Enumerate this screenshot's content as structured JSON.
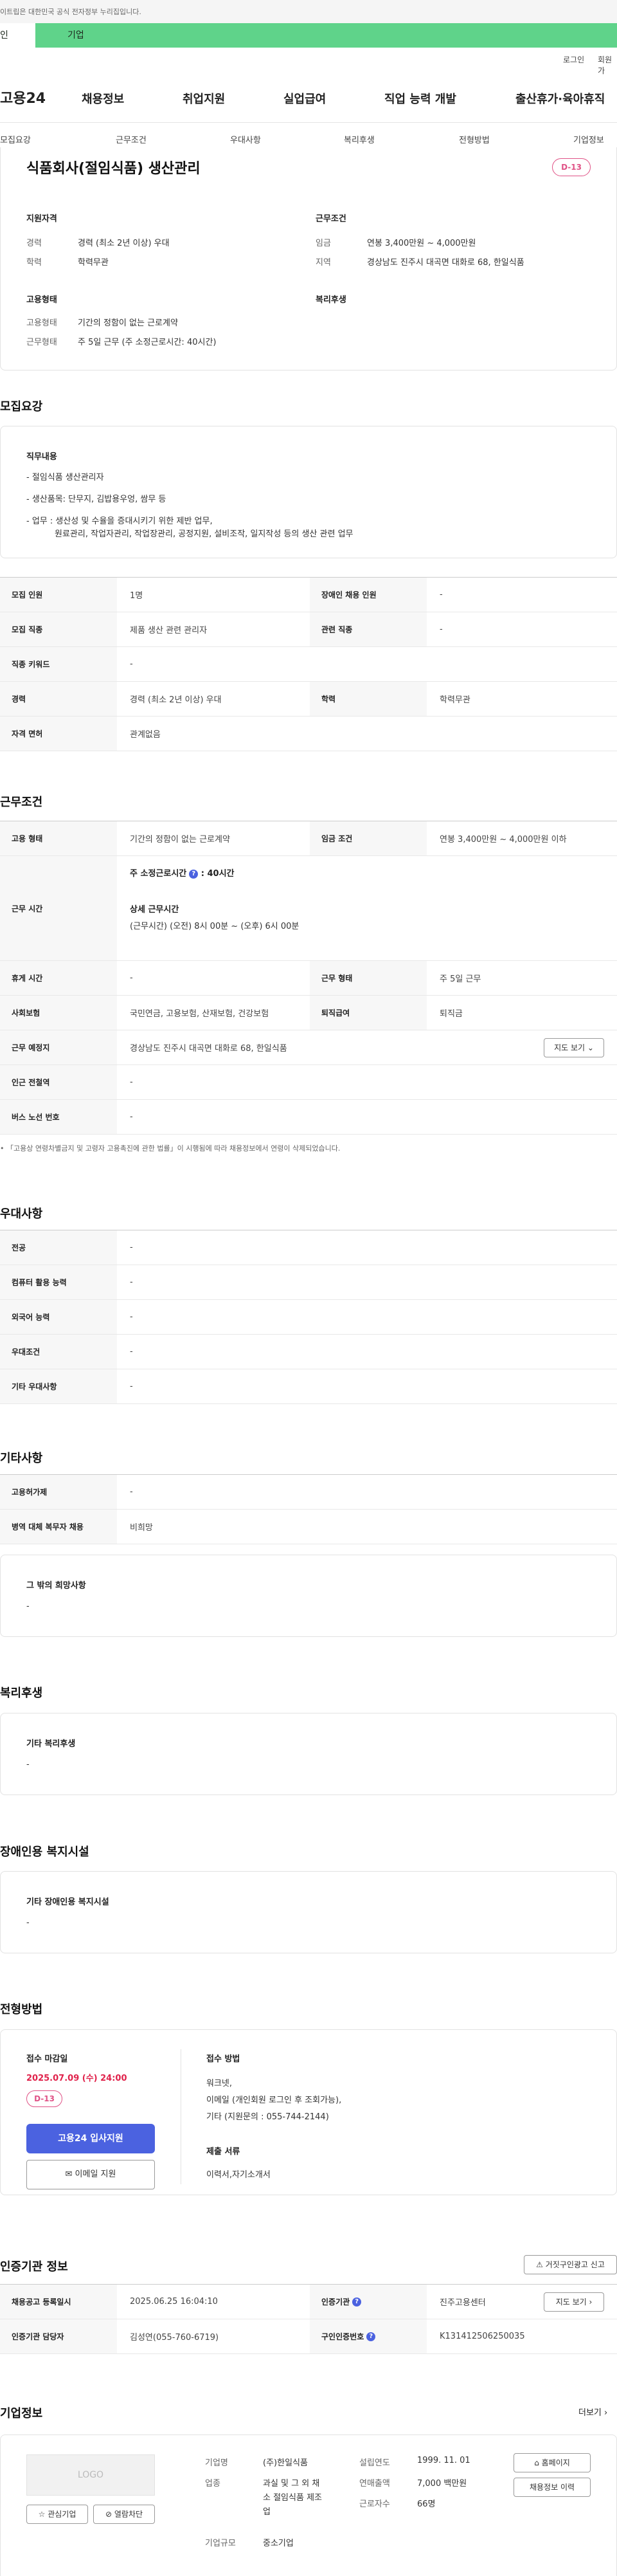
{
  "gov_banner": "이트립은 대한민국 공식 전자정부 누리집입니다.",
  "user_tabs": [
    "인",
    "기업"
  ],
  "util": {
    "login": "로그인",
    "signup": "회원가"
  },
  "logo": "고용24",
  "gnb": [
    "채용정보",
    "취업지원",
    "실업급여",
    "직업 능력 개발",
    "출산휴가·육아휴직"
  ],
  "anchors": [
    "모집요강",
    "근무조건",
    "우대사항",
    "복리후생",
    "전형방법",
    "기업정보"
  ],
  "summary": {
    "title": "식품회사(절임식품) 생산관리",
    "dday": "D-13",
    "applicant_title": "지원자격",
    "career_label": "경력",
    "career": "경력 (최소 2년 이상) 우대",
    "edu_label": "학력",
    "edu": "학력무관",
    "work_title": "근무조건",
    "wage_label": "임금",
    "wage": "연봉 3,400만원 ~ 4,000만원",
    "region_label": "지역",
    "region": "경상남도 진주시 대곡면 대화로 68, 한일식품",
    "emp_title": "고용형태",
    "emp_type_label": "고용형태",
    "emp_type": "기간의 정함이 없는 근로계약",
    "work_form_label": "근무형태",
    "work_form": "주 5일 근무 (주 소정근로시간: 40시간)",
    "welfare_title": "복리후생"
  },
  "recruit": {
    "title": "모집요강",
    "duty_title": "직무내용",
    "duty_lines": [
      "- 절임식품 생산관리자",
      "- 생산품목: 단무지, 김밥용우엉, 쌈무 등",
      "- 업무 : 생산성 및 수율을 증대시키기 위한 제반 업무,",
      "원료관리, 작업자관리, 작업장관리, 공정지원, 설비조작, 일지작성 등의 생산 관련 업무"
    ],
    "rows": [
      [
        "모집 인원",
        "1명",
        "장애인 채용 인원",
        "-"
      ],
      [
        "모집 직종",
        "제품 생산 관련 관리자",
        "관련 직종",
        "-"
      ],
      [
        "직종 키워드",
        "-",
        "",
        ""
      ],
      [
        "경력",
        "경력 (최소 2년 이상) 우대",
        "학력",
        "학력무관"
      ],
      [
        "자격 면허",
        "관계없음",
        "",
        ""
      ]
    ]
  },
  "conditions": {
    "title": "근무조건",
    "emp_label": "고용 형태",
    "emp": "기간의 정함이 없는 근로계약",
    "wage_label": "임금 조건",
    "wage": "연봉 3,400만원 ~ 4,000만원 이하",
    "time_label": "근무 시간",
    "weekly": "주 소정근로시간",
    "weekly_val": ": 40시간",
    "detail_title": "상세 근무시간",
    "detail": "(근무시간) (오전) 8시 00분 ~ (오후) 6시 00분",
    "rows": [
      [
        "휴게 시간",
        "-",
        "근무 형태",
        "주 5일 근무"
      ],
      [
        "사회보험",
        "국민연금, 고용보험, 산재보험, 건강보험",
        "퇴직급여",
        "퇴직금"
      ]
    ],
    "place_label": "근무 예정지",
    "place": "경상남도 진주시 대곡면 대화로 68, 한일식품",
    "map_btn": "지도 보기",
    "station_label": "인근 전철역",
    "station": "-",
    "bus_label": "버스 노선 번호",
    "bus": "-",
    "note": "「고용상 연령차별금지 및 고령자 고용촉진에 관한 법률」이 시행됨에 따라 채용정보에서 연령이 삭제되었습니다."
  },
  "pref": {
    "title": "우대사항",
    "rows": [
      [
        "전공",
        "-"
      ],
      [
        "컴퓨터 활용 능력",
        "-"
      ],
      [
        "외국어 능력",
        "-"
      ],
      [
        "우대조건",
        "-"
      ],
      [
        "기타 우대사항",
        "-"
      ]
    ]
  },
  "etc": {
    "title": "기타사항",
    "rows": [
      [
        "고용허가제",
        "-"
      ],
      [
        "병역 대체 복무자 채용",
        "비희망"
      ]
    ],
    "other_title": "그 밖의 희망사항",
    "other": "-"
  },
  "welfare": {
    "title": "복리후생",
    "sub": "기타 복리후생",
    "val": "-"
  },
  "disabled": {
    "title": "장애인용 복지시설",
    "sub": "기타 장애인용 복지시설",
    "val": "-"
  },
  "process": {
    "title": "전형방법",
    "deadline_title": "접수 마감일",
    "deadline": "2025.07.09 (수) 24:00",
    "dday": "D-13",
    "apply_btn": "고용24 입사지원",
    "email_btn": "이메일 지원",
    "method_title": "접수 방법",
    "method_lines": [
      "워크넷,",
      "이메일 (개인회원 로그인 후 조회가능),",
      "기타 (지원문의 : 055-744-2144)"
    ],
    "docs_title": "제출 서류",
    "docs": "이력서,자기소개서"
  },
  "agency": {
    "title": "인증기관 정보",
    "report_btn": "거짓구인광고 신고",
    "rows": [
      [
        "채용공고 등록일시",
        "2025.06.25 16:04:10",
        "인증기관",
        "진주고용센터"
      ],
      [
        "인증기관 담당자",
        "김성연(055-760-6719)",
        "구인인증번호",
        "K131412506250035"
      ]
    ],
    "map_btn": "지도 보기"
  },
  "company": {
    "title": "기업정보",
    "more": "더보기",
    "logo": "LOGO",
    "fav_btn": "관심기업",
    "block_btn": "열람차단",
    "name_label": "기업명",
    "name": "(주)한일식품",
    "industry_label": "업종",
    "industry_lines": [
      "과실 및 그 외 채",
      "소 절임식품 제조",
      "업"
    ],
    "size_label": "기업규모",
    "size": "중소기업",
    "founded_label": "설립연도",
    "founded": "1999. 11. 01",
    "sales_label": "연매출액",
    "sales": "7,000 백만원",
    "staff_label": "근로자수",
    "staff": "66명",
    "home_btn": "홈페이지",
    "jobs_btn": "채용정보 이력"
  }
}
